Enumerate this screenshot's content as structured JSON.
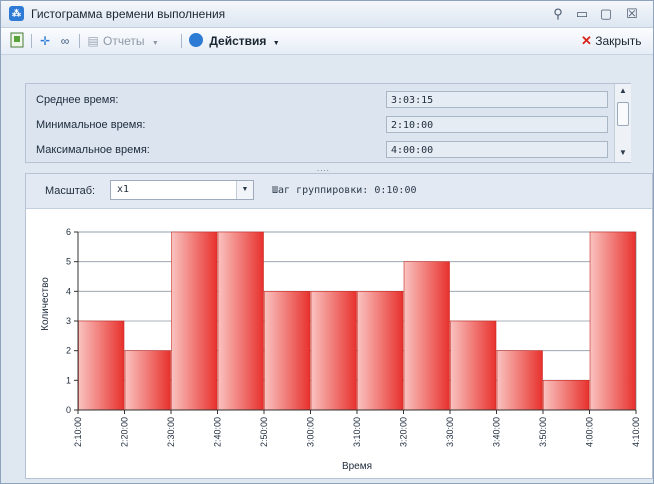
{
  "window": {
    "title": "Гистограмма времени выполнения",
    "controls": {
      "pin": "⚲",
      "minimize": "▭",
      "maximize": "▢",
      "close": "☒"
    }
  },
  "toolbar": {
    "reports_label": "Отчеты",
    "actions_label": "Действия",
    "close_label": "Закрыть"
  },
  "stats": [
    {
      "label": "Среднее время:",
      "value": "3:03:15"
    },
    {
      "label": "Минимальное время:",
      "value": "2:10:00"
    },
    {
      "label": "Максимальное время:",
      "value": "4:00:00"
    }
  ],
  "splitter_grip": "....",
  "chart_controls": {
    "scale_label": "Масштаб:",
    "scale_value": "x1",
    "group_step_label": "Шаг группировки: 0:10:00"
  },
  "colors": {
    "bar_light": "#f9c3c0",
    "bar_dark": "#e8312d",
    "accent_blue": "#2d7bd4",
    "close_red": "#d9241c"
  },
  "chart_data": {
    "type": "bar",
    "title": "",
    "xlabel": "Время",
    "ylabel": "Количество",
    "categories": [
      "2:10:00",
      "2:20:00",
      "2:30:00",
      "2:40:00",
      "2:50:00",
      "3:00:00",
      "3:10:00",
      "3:20:00",
      "3:30:00",
      "3:40:00",
      "3:50:00",
      "4:00:00",
      "4:10:00"
    ],
    "values": [
      3,
      2,
      6,
      6,
      4,
      4,
      4,
      5,
      3,
      2,
      1,
      6
    ],
    "ylim": [
      0,
      6
    ],
    "yticks": [
      0,
      1,
      2,
      3,
      4,
      5,
      6
    ],
    "grid": true
  }
}
